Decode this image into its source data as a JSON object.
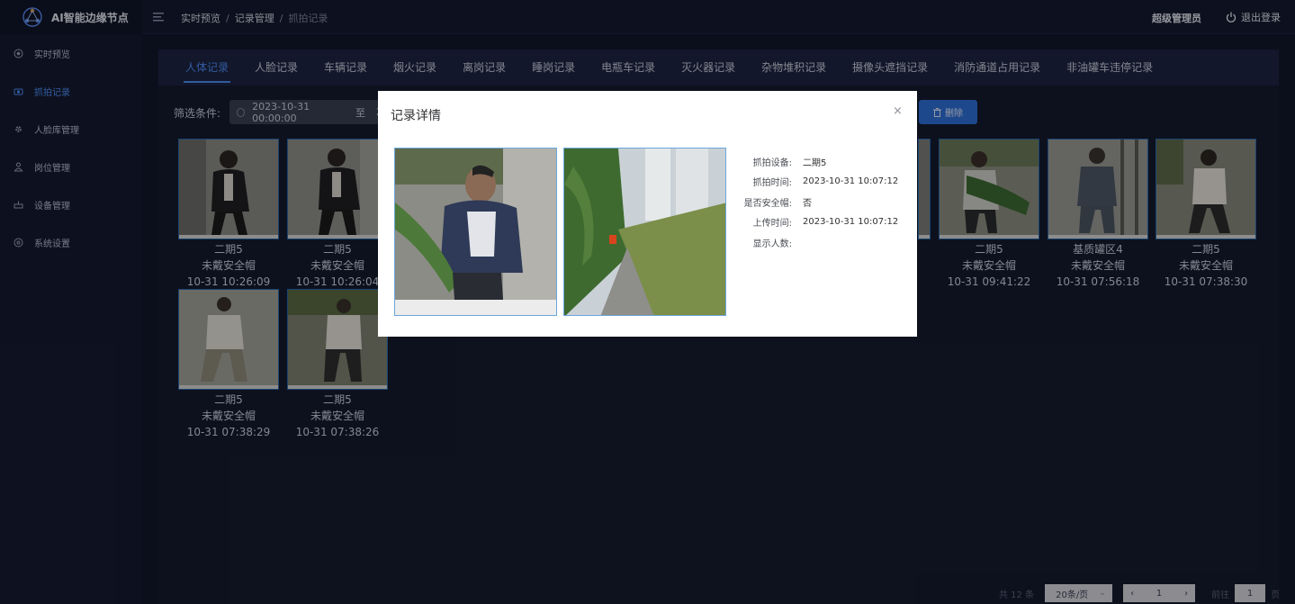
{
  "app": {
    "title": "AI智能边缘节点"
  },
  "breadcrumb": {
    "item1": "实时预览",
    "item2": "记录管理",
    "item3": "抓拍记录"
  },
  "user": {
    "name": "超级管理员",
    "logout_label": "退出登录"
  },
  "sidebar": {
    "items": [
      {
        "label": "实时预览",
        "icon": "eye-icon"
      },
      {
        "label": "抓拍记录",
        "icon": "camera-icon"
      },
      {
        "label": "人脸库管理",
        "icon": "gear-icon"
      },
      {
        "label": "岗位管理",
        "icon": "person-icon"
      },
      {
        "label": "设备管理",
        "icon": "device-icon"
      },
      {
        "label": "系统设置",
        "icon": "settings-icon"
      }
    ]
  },
  "tabs": [
    {
      "label": "人体记录"
    },
    {
      "label": "人脸记录"
    },
    {
      "label": "车辆记录"
    },
    {
      "label": "烟火记录"
    },
    {
      "label": "离岗记录"
    },
    {
      "label": "睡岗记录"
    },
    {
      "label": "电瓶车记录"
    },
    {
      "label": "灭火器记录"
    },
    {
      "label": "杂物堆积记录"
    },
    {
      "label": "摄像头遮挡记录"
    },
    {
      "label": "消防通道占用记录"
    },
    {
      "label": "非油罐车违停记录"
    }
  ],
  "filter": {
    "label": "筛选条件:",
    "start_date": "2023-10-31 00:00:00",
    "to_label": "至",
    "end_date_partial": "2",
    "delete_label": "删除"
  },
  "cards": [
    {
      "device": "二期5",
      "status": "未戴安全帽",
      "time": "10-31 10:26:09"
    },
    {
      "device": "二期5",
      "status": "未戴安全帽",
      "time": "10-31 10:26:04"
    },
    {
      "device": "二期5",
      "status": "未戴安全帽",
      "time": "10-31 09:41:22"
    },
    {
      "device": "基质罐区4",
      "status": "未戴安全帽",
      "time": "10-31 07:56:18"
    },
    {
      "device": "二期5",
      "status": "未戴安全帽",
      "time": "10-31 07:38:30"
    },
    {
      "device": "二期5",
      "status": "未戴安全帽",
      "time": "10-31 07:38:29"
    },
    {
      "device": "二期5",
      "status": "未戴安全帽",
      "time": "10-31 07:38:26"
    }
  ],
  "pagination": {
    "total": "共 12 条",
    "page_size": "20条/页",
    "current_page": "1",
    "goto_label": "前往",
    "goto_value": "1",
    "page_suffix": "页"
  },
  "modal": {
    "title": "记录详情",
    "close": "×",
    "fields": [
      {
        "label": "抓拍设备:",
        "value": "二期5"
      },
      {
        "label": "抓拍时间:",
        "value": "2023-10-31 10:07:12"
      },
      {
        "label": "是否安全帽:",
        "value": "否"
      },
      {
        "label": "上传时间:",
        "value": "2023-10-31 10:07:12"
      },
      {
        "label": "显示人数:",
        "value": ""
      }
    ]
  },
  "colors": {
    "accent": "#4e8cf5",
    "background": "#12172b",
    "sidebar": "#151b31"
  }
}
